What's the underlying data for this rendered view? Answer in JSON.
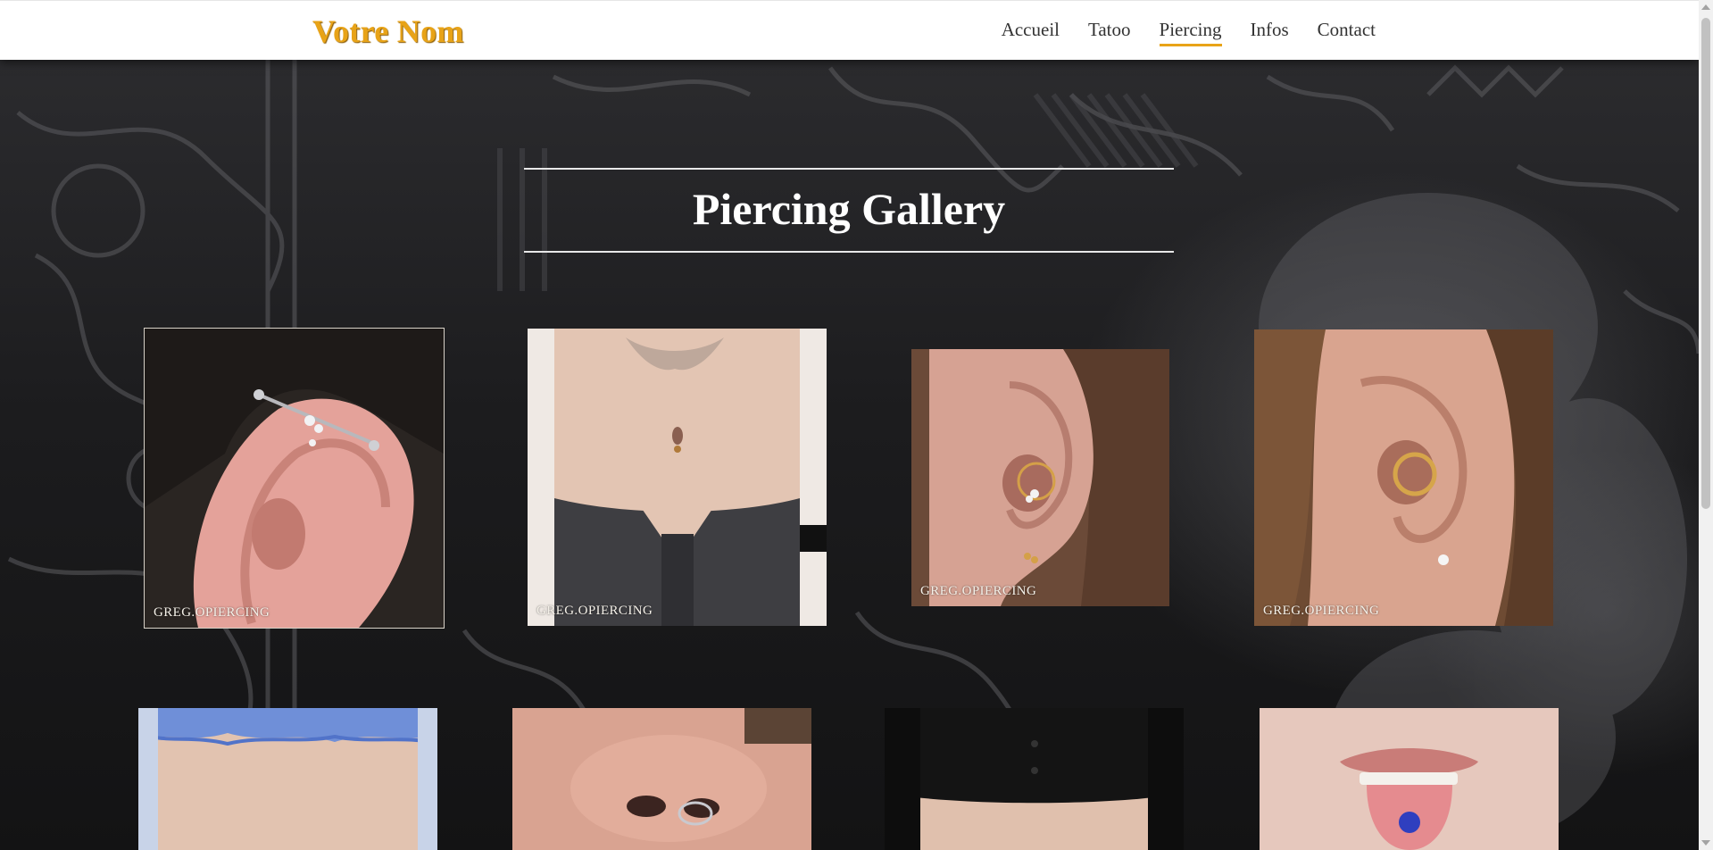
{
  "brand": {
    "name": "Votre Nom"
  },
  "nav": {
    "items": [
      {
        "label": "Accueil",
        "active": false
      },
      {
        "label": "Tatoo",
        "active": false
      },
      {
        "label": "Piercing",
        "active": true
      },
      {
        "label": "Infos",
        "active": false
      },
      {
        "label": "Contact",
        "active": false
      }
    ]
  },
  "page": {
    "title": "Piercing Gallery"
  },
  "gallery": {
    "watermark": "GREG.OPIERCING",
    "photos": [
      {
        "subject": "industrial ear piercing",
        "watermark": "GREG.OPIERCING"
      },
      {
        "subject": "navel piercing",
        "watermark": "GREG.OPIERCING"
      },
      {
        "subject": "daith ear piercing",
        "watermark": "GREG.OPIERCING"
      },
      {
        "subject": "daith ring ear piercing",
        "watermark": "GREG.OPIERCING"
      },
      {
        "subject": "lower back",
        "watermark": ""
      },
      {
        "subject": "septum nose piercing",
        "watermark": ""
      },
      {
        "subject": "navel piercing",
        "watermark": ""
      },
      {
        "subject": "tongue piercing",
        "watermark": ""
      }
    ]
  },
  "colors": {
    "accent": "#e8a317",
    "header_bg": "#ffffff",
    "page_bg": "#1a1a1c",
    "title": "#ffffff"
  }
}
